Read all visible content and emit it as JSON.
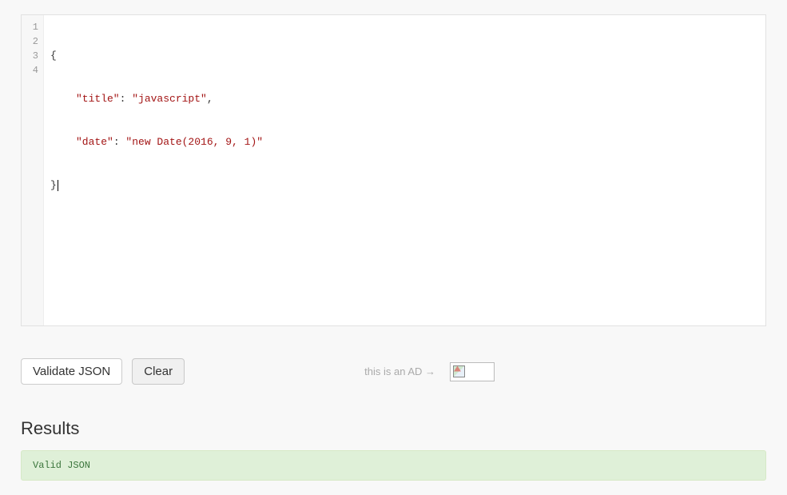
{
  "editor": {
    "line_numbers": [
      "1",
      "2",
      "3",
      "4"
    ],
    "lines": {
      "l1_open": "{",
      "l2_key": "\"title\"",
      "l2_colon": ": ",
      "l2_val": "\"javascript\"",
      "l2_comma": ",",
      "l3_key": "\"date\"",
      "l3_colon": ": ",
      "l3_val": "\"new Date(2016, 9, 1)\"",
      "l4_close": "}"
    }
  },
  "buttons": {
    "validate": "Validate JSON",
    "clear": "Clear"
  },
  "ad": {
    "label": "this is an AD →"
  },
  "results": {
    "heading": "Results",
    "message": "Valid JSON"
  }
}
